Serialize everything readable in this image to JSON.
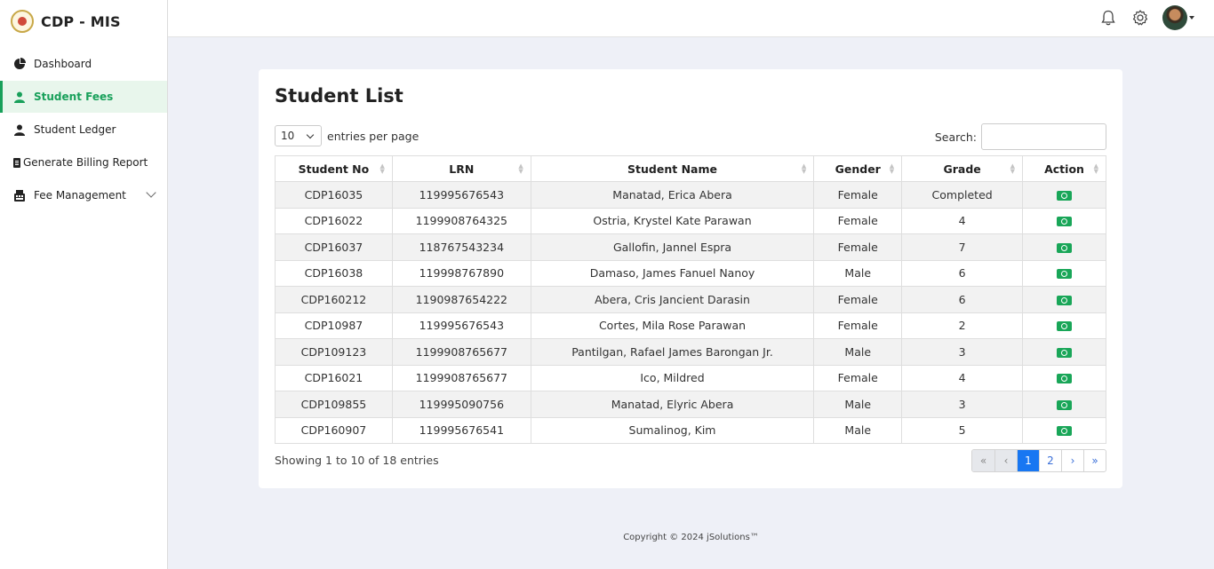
{
  "app": {
    "title": "CDP - MIS"
  },
  "sidebar": {
    "items": [
      {
        "label": "Dashboard",
        "icon": "pie-chart-icon"
      },
      {
        "label": "Student Fees",
        "icon": "user-icon",
        "active": true
      },
      {
        "label": "Student Ledger",
        "icon": "user-icon"
      },
      {
        "label": "Generate Billing Report",
        "icon": "file-icon"
      },
      {
        "label": "Fee Management",
        "icon": "cash-register-icon"
      }
    ]
  },
  "topbar": {
    "icons": [
      "bell-icon",
      "gear-icon",
      "avatar"
    ]
  },
  "page": {
    "title": "Student List",
    "per_page_value": "10",
    "per_page_label": "entries per page",
    "search_label": "Search:",
    "search_placeholder": ""
  },
  "table": {
    "columns": [
      "Student No",
      "LRN",
      "Student Name",
      "Gender",
      "Grade",
      "Action"
    ],
    "rows": [
      [
        "CDP16035",
        "119995676543",
        "Manatad, Erica Abera",
        "Female",
        "Completed"
      ],
      [
        "CDP16022",
        "1199908764325",
        "Ostria, Krystel Kate Parawan",
        "Female",
        "4"
      ],
      [
        "CDP16037",
        "118767543234",
        "Gallofin, Jannel Espra",
        "Female",
        "7"
      ],
      [
        "CDP16038",
        "119998767890",
        "Damaso, James Fanuel Nanoy",
        "Male",
        "6"
      ],
      [
        "CDP160212",
        "1190987654222",
        "Abera, Cris Jancient Darasin",
        "Female",
        "6"
      ],
      [
        "CDP10987",
        "119995676543",
        "Cortes, Mila Rose Parawan",
        "Female",
        "2"
      ],
      [
        "CDP109123",
        "1199908765677",
        "Pantilgan, Rafael James Barongan Jr.",
        "Male",
        "3"
      ],
      [
        "CDP16021",
        "1199908765677",
        "Ico, Mildred",
        "Female",
        "4"
      ],
      [
        "CDP109855",
        "119995090756",
        "Manatad, Elyric Abera",
        "Male",
        "3"
      ],
      [
        "CDP160907",
        "119995676541",
        "Sumalinog, Kim",
        "Male",
        "5"
      ]
    ],
    "action_icon": "money-bill-icon"
  },
  "pagination": {
    "info": "Showing 1 to 10 of 18 entries",
    "buttons": [
      "«",
      "‹",
      "1",
      "2",
      "›",
      "»"
    ],
    "active": "1"
  },
  "footer": {
    "text": "Copyright © 2024 jSolutions™"
  },
  "colors": {
    "accent": "#18a05a",
    "primary": "#1877f2"
  }
}
